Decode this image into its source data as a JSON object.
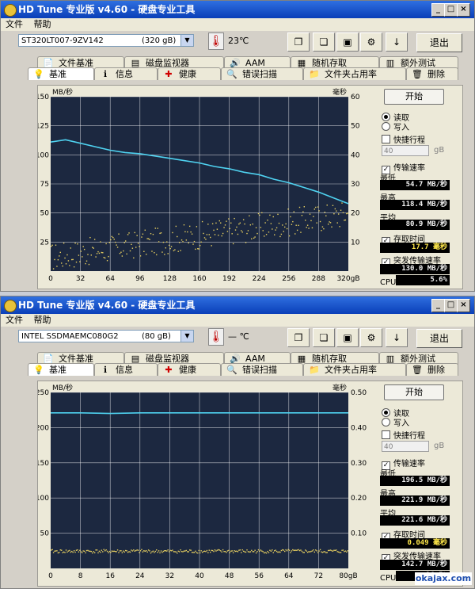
{
  "window1": {
    "title": "HD Tune 专业版 v4.60 - 硬盘专业工具",
    "menu": [
      "文件",
      "帮助"
    ],
    "drive_name": "ST320LT007-9ZV142",
    "drive_capacity": "(320 gB)",
    "temperature": "23℃",
    "exit_label": "退出",
    "tabs_row1": [
      "文件基准",
      "磁盘监视器",
      "AAM",
      "随机存取",
      "额外测试"
    ],
    "tabs_row2": [
      "基准",
      "信息",
      "健康",
      "错误扫描",
      "文件夹占用率",
      "删除"
    ],
    "start_label": "开始",
    "read_label": "读取",
    "write_label": "写入",
    "quick_stroke_label": "快捷行程",
    "stroke_value": "40",
    "stroke_unit": "gB",
    "transfer_rate_label": "传输速率",
    "min_label": "最低",
    "min_value": "54.7 MB/秒",
    "max_label": "最高",
    "max_value": "118.4 MB/秒",
    "avg_label": "平均",
    "avg_value": "80.9 MB/秒",
    "access_time_label": "存取时间",
    "access_time_value": "17.7 毫秒",
    "burst_label": "突发传输速率",
    "burst_value": "130.0 MB/秒",
    "cpu_label": "CPU 占用率",
    "cpu_value": "5.6%"
  },
  "window2": {
    "title": "HD Tune 专业版 v4.60 - 硬盘专业工具",
    "menu": [
      "文件",
      "帮助"
    ],
    "drive_name": "INTEL SSDMAEMC080G2",
    "drive_capacity": "(80 gB)",
    "temperature": "— ℃",
    "exit_label": "退出",
    "tabs_row1": [
      "文件基准",
      "磁盘监视器",
      "AAM",
      "随机存取",
      "额外测试"
    ],
    "tabs_row2": [
      "基准",
      "信息",
      "健康",
      "错误扫描",
      "文件夹占用率",
      "删除"
    ],
    "start_label": "开始",
    "read_label": "读取",
    "write_label": "写入",
    "quick_stroke_label": "快捷行程",
    "stroke_value": "40",
    "stroke_unit": "gB",
    "transfer_rate_label": "传输速率",
    "min_label": "最低",
    "min_value": "196.5 MB/秒",
    "max_label": "最高",
    "max_value": "221.9 MB/秒",
    "avg_label": "平均",
    "avg_value": "221.6 MB/秒",
    "access_time_label": "存取时间",
    "access_time_value": "0.049 毫秒",
    "burst_label": "突发传输速率",
    "burst_value": "142.7 MB/秒",
    "cpu_label": "CPU 占用率",
    "cpu_value": "16.5%"
  },
  "watermark": "okajax.com",
  "chart_data": [
    {
      "type": "line",
      "y_left_label": "MB/秒",
      "y_right_label": "毫秒",
      "x_unit": "gB",
      "x_ticks": [
        "0",
        "32",
        "64",
        "96",
        "128",
        "160",
        "192",
        "224",
        "256",
        "288",
        "320gB"
      ],
      "y_left_ticks": [
        "25",
        "50",
        "75",
        "100",
        "125",
        "150"
      ],
      "y_right_ticks": [
        "10",
        "20",
        "30",
        "40",
        "50",
        "60"
      ],
      "xlim": [
        0,
        320
      ],
      "ylim_left": [
        0,
        150
      ],
      "ylim_right": [
        0,
        60
      ],
      "series": [
        {
          "name": "传输速率",
          "axis": "left",
          "x": [
            0,
            16,
            32,
            48,
            64,
            80,
            96,
            112,
            128,
            144,
            160,
            176,
            192,
            208,
            224,
            240,
            256,
            272,
            288,
            304,
            320
          ],
          "values": [
            111,
            113,
            110,
            107,
            104,
            102,
            101,
            99,
            97,
            95,
            93,
            90,
            88,
            85,
            83,
            79,
            76,
            72,
            68,
            63,
            58
          ]
        },
        {
          "name": "存取时间",
          "axis": "right",
          "kind": "scatter",
          "x_range": [
            0,
            320
          ],
          "y_start": 5,
          "y_end": 20
        }
      ],
      "colors": {
        "transfer": "#4fd2f0",
        "access": "#e8d060",
        "background": "#1c2840",
        "grid": "#ffffff"
      }
    },
    {
      "type": "line",
      "y_left_label": "MB/秒",
      "y_right_label": "毫秒",
      "x_unit": "gB",
      "x_ticks": [
        "0",
        "8",
        "16",
        "24",
        "32",
        "40",
        "48",
        "56",
        "64",
        "72",
        "80gB"
      ],
      "y_left_ticks": [
        "50",
        "100",
        "150",
        "200",
        "250"
      ],
      "y_right_ticks": [
        "0.10",
        "0.20",
        "0.30",
        "0.40",
        "0.50"
      ],
      "xlim": [
        0,
        80
      ],
      "ylim_left": [
        0,
        250
      ],
      "ylim_right": [
        0,
        0.5
      ],
      "series": [
        {
          "name": "传输速率",
          "axis": "left",
          "x": [
            0,
            8,
            16,
            24,
            32,
            40,
            48,
            56,
            64,
            72,
            80
          ],
          "values": [
            221,
            221,
            220,
            221,
            221,
            221,
            221,
            221,
            221,
            221,
            221
          ]
        },
        {
          "name": "存取时间",
          "axis": "right",
          "kind": "scatter",
          "x_range": [
            0,
            80
          ],
          "y_start": 0.05,
          "y_end": 0.05
        }
      ],
      "colors": {
        "transfer": "#4fd2f0",
        "access": "#e8d060",
        "background": "#1c2840",
        "grid": "#ffffff"
      }
    }
  ]
}
